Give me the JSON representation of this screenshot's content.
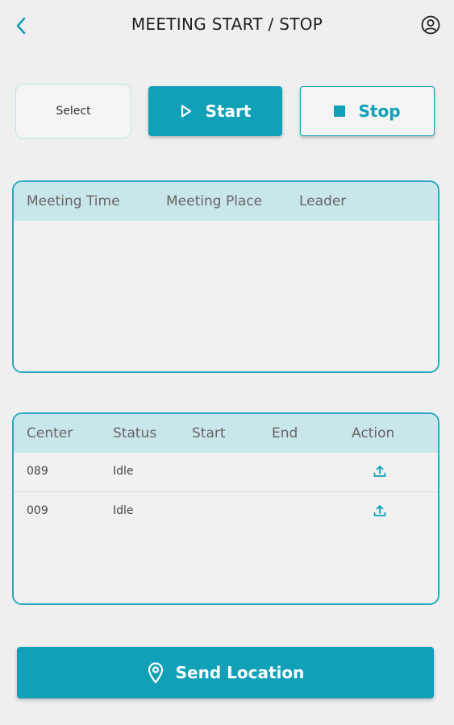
{
  "header": {
    "title": "MEETING START / STOP",
    "back_icon": "chevron-left-icon",
    "profile_icon": "user-circle-icon"
  },
  "controls": {
    "select_label": "Select",
    "start_label": "Start",
    "stop_label": "Stop"
  },
  "meeting_table": {
    "columns": [
      "Meeting Time",
      "Meeting Place",
      "Leader"
    ],
    "rows": []
  },
  "center_table": {
    "columns": [
      "Center",
      "Status",
      "Start",
      "End",
      "Action"
    ],
    "rows": [
      {
        "center": "089",
        "status": "Idle",
        "start": "",
        "end": "",
        "action_icon": "upload-icon"
      },
      {
        "center": "009",
        "status": "Idle",
        "start": "",
        "end": "",
        "action_icon": "upload-icon"
      }
    ]
  },
  "footer": {
    "send_location_label": "Send Location",
    "location_icon": "map-pin-icon"
  },
  "colors": {
    "accent": "#10a0b8",
    "header_row": "#c9e6ea",
    "background": "#efefef"
  }
}
